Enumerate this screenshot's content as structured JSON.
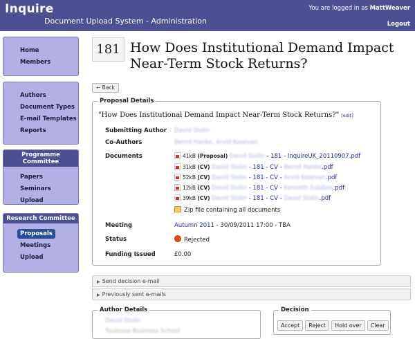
{
  "header": {
    "app_title": "Inquire",
    "subtitle": "Document Upload System - Administration",
    "login_prefix": "You are logged in as",
    "username": "MattWeaver",
    "logout_label": "Logout"
  },
  "sidebar": {
    "nav1": [
      {
        "label": "Home"
      },
      {
        "label": "Members"
      }
    ],
    "nav2": [
      {
        "label": "Authors"
      },
      {
        "label": "Document Types"
      },
      {
        "label": "E-mail Templates"
      },
      {
        "label": "Reports"
      }
    ],
    "programme": {
      "title": "Programme Committee",
      "items": [
        {
          "label": "Papers"
        },
        {
          "label": "Seminars"
        },
        {
          "label": "Upload"
        }
      ]
    },
    "research": {
      "title": "Research Committee",
      "items": [
        {
          "label": "Proposals"
        },
        {
          "label": "Meetings"
        },
        {
          "label": "Upload"
        }
      ]
    }
  },
  "proposal": {
    "id": "181",
    "title": "How Does Institutional Demand Impact Near-Term Stock Returns?",
    "back_label": "← Back",
    "details_legend": "Proposal Details",
    "quoted_title": "\"How Does Institutional Demand Impact Near-Term Stock Returns?\"",
    "edit_label": "[edit]",
    "submitting_author_label": "Submitting Author",
    "submitting_author_value": "David Stolin",
    "coauthors_label": "Co-Authors",
    "coauthors_value": "Bernd Hanke, Arvid Koxevan",
    "documents_label": "Documents",
    "documents": [
      {
        "size": "41kB",
        "kind": "(Proposal)",
        "who": "David Stolin",
        "link": "- 181 - InquireUK_20110907.pdf"
      },
      {
        "size": "31kB",
        "kind": "(CV)",
        "who": "David Stolin",
        "link": "- 181 - CV - ",
        "tail_blur": "Bernd Hanke",
        "tail": ".pdf"
      },
      {
        "size": "52kB",
        "kind": "(CV)",
        "who": "David Stolin",
        "link": "- 181 - CV - ",
        "tail_blur": "Arvid Koxevan",
        "tail": ".pdf"
      },
      {
        "size": "12kB",
        "kind": "(CV)",
        "who": "David Stolin",
        "link": "- 181 - CV - ",
        "tail_blur": "Kenneth Sulabes",
        "tail": ".pdf"
      },
      {
        "size": "39kB",
        "kind": "(CV)",
        "who": "David Stolin",
        "link": "- 181 - CV - ",
        "tail_blur": "David Stolin",
        "tail": ".pdf"
      }
    ],
    "zip_label": "Zip file containing all documents",
    "meeting_label": "Meeting",
    "meeting_link": "Autumn 2011",
    "meeting_rest": " - 30/09/2011 17:00 - TBA",
    "status_label": "Status",
    "status_value": "Rejected",
    "status_color": "#e24c1a",
    "funding_label": "Funding Issued",
    "funding_value": "£0.00"
  },
  "collapsibles": {
    "send_decision": "Send decision e-mail",
    "previous_emails": "Previously sent e-mails"
  },
  "author_details": {
    "legend": "Author Details",
    "name": "David Stolin",
    "affiliation": "Toulouse Business School"
  },
  "decision": {
    "legend": "Decision",
    "accept": "Accept",
    "reject": "Reject",
    "hold": "Hold over",
    "clear": "Clear"
  }
}
